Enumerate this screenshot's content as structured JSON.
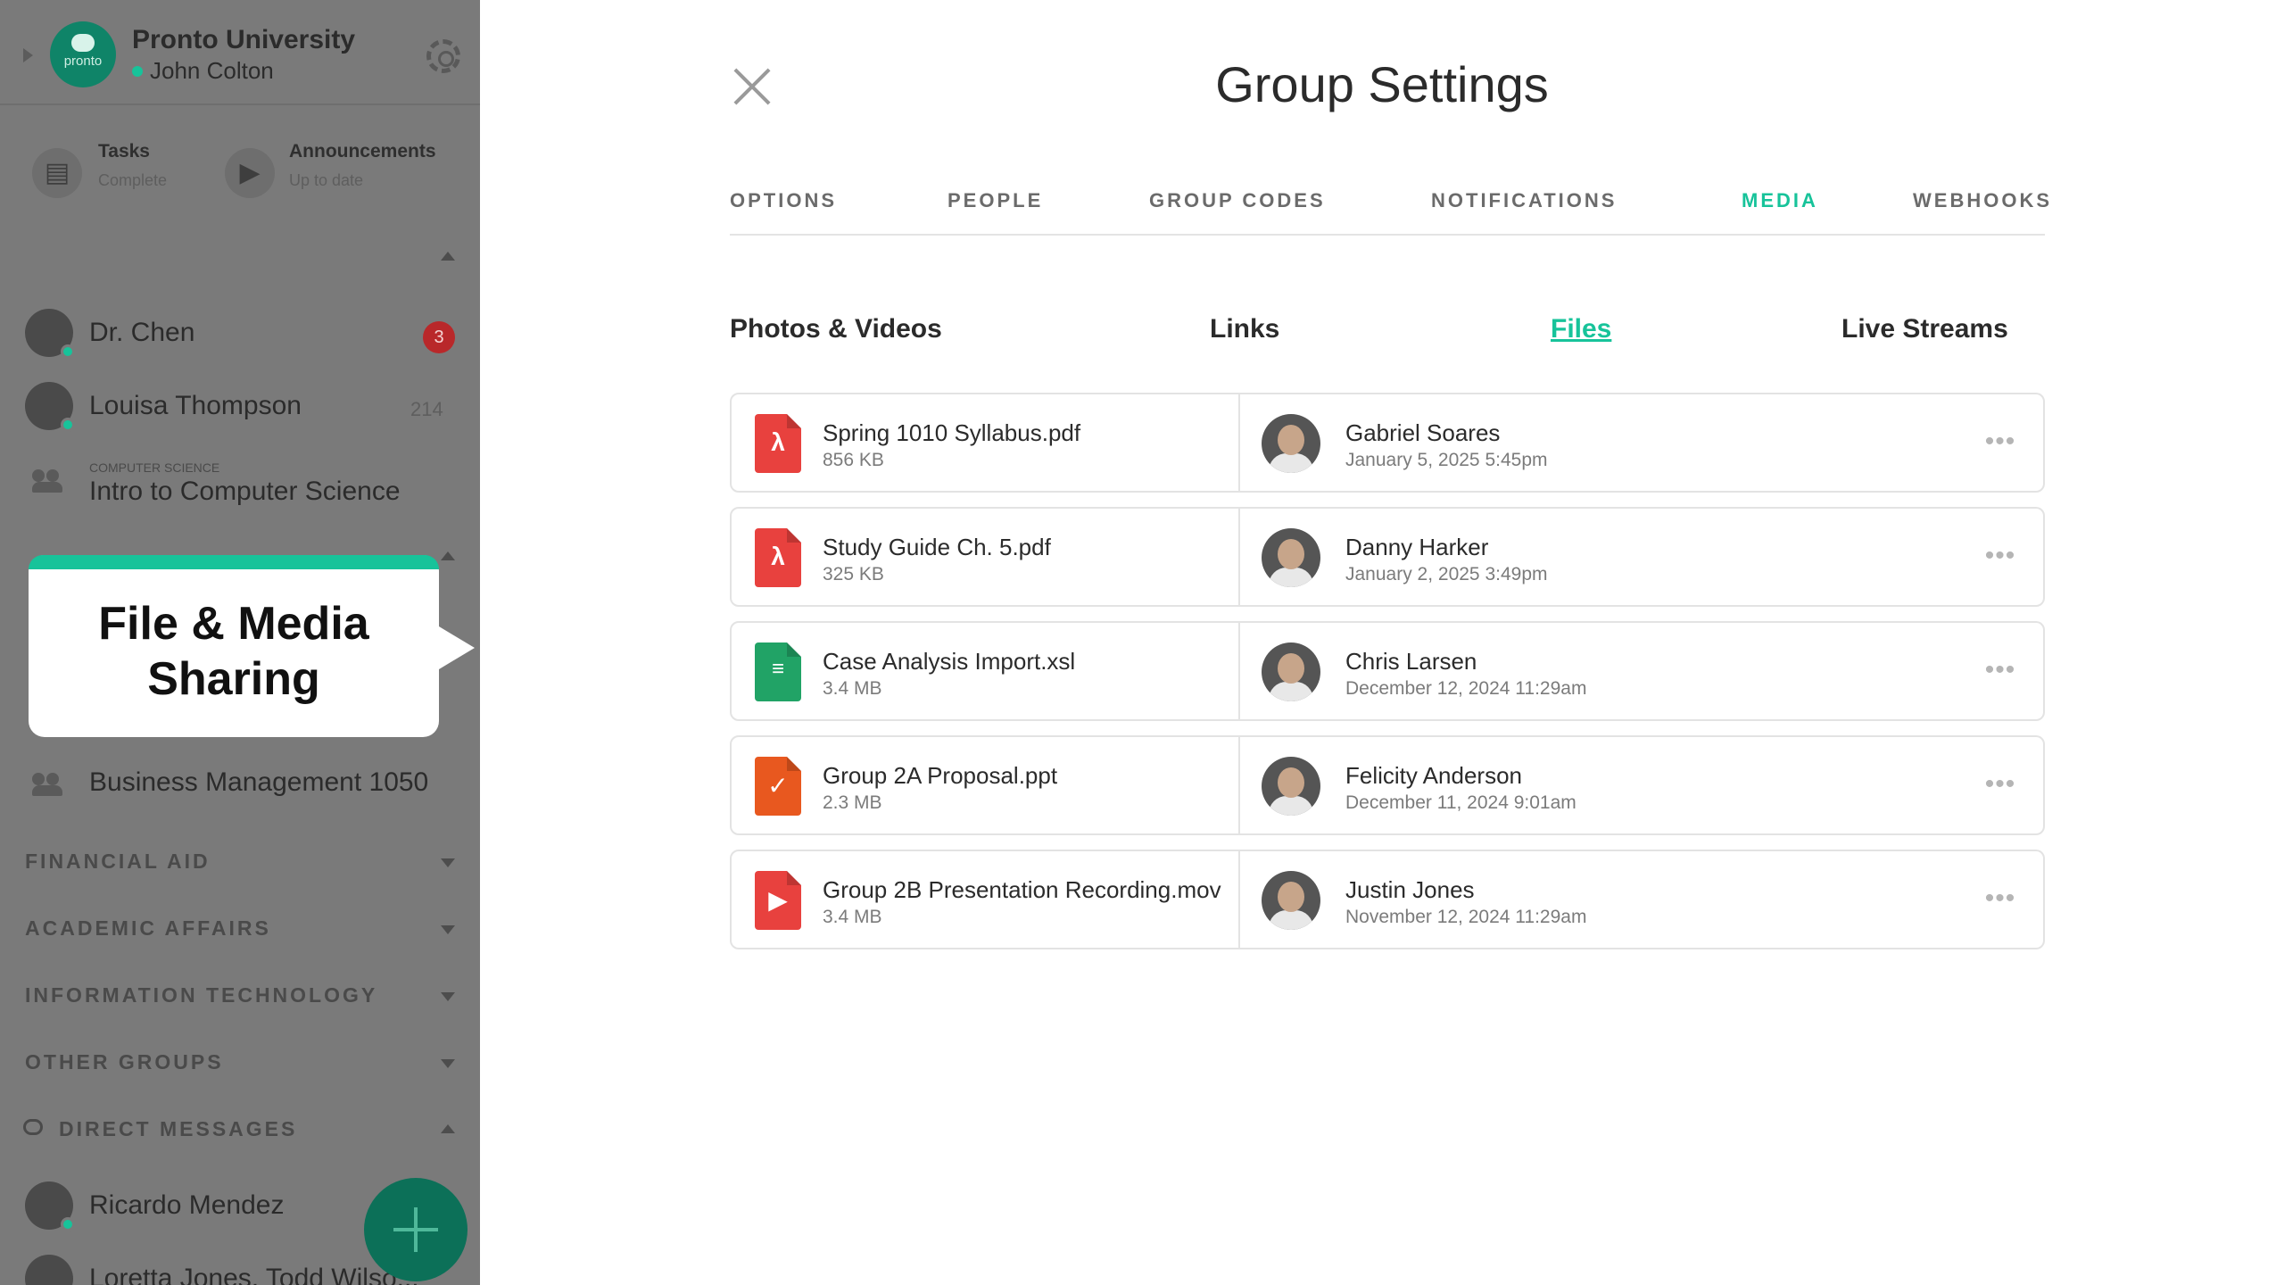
{
  "sidebar": {
    "org_name": "Pronto University",
    "logo_text": "pronto",
    "user_name": "John Colton",
    "status": [
      {
        "title": "Tasks",
        "sub": "Complete",
        "icon": "clipboard-icon"
      },
      {
        "title": "Announcements",
        "sub": "Up to date",
        "icon": "megaphone-icon"
      }
    ],
    "chats": [
      {
        "name": "Dr. Chen",
        "badge": "3"
      },
      {
        "name": "Louisa Thompson",
        "count": "214"
      }
    ],
    "group": {
      "category": "COMPUTER SCIENCE",
      "name": "Intro to Computer Science"
    },
    "group2": {
      "name": "Business Management 1050"
    },
    "sections": [
      "FINANCIAL AID",
      "ACADEMIC AFFAIRS",
      "INFORMATION TECHNOLOGY",
      "OTHER GROUPS"
    ],
    "direct_messages_label": "DIRECT MESSAGES",
    "dms": [
      "Ricardo Mendez",
      "Loretta Jones, Todd Wilso..."
    ],
    "callout_line1": "File & Media",
    "callout_line2": "Sharing",
    "colors": {
      "accent": "#17c39a",
      "badge": "#b9282a"
    }
  },
  "modal": {
    "title": "Group Settings",
    "tabs": [
      "OPTIONS",
      "PEOPLE",
      "GROUP CODES",
      "NOTIFICATIONS",
      "MEDIA",
      "WEBHOOKS"
    ],
    "active_tab": "MEDIA",
    "subtabs": [
      "Photos & Videos",
      "Links",
      "Files",
      "Live Streams"
    ],
    "active_subtab": "Files",
    "files": [
      {
        "name": "Spring 1010 Syllabus.pdf",
        "size": "856 KB",
        "type": "pdf",
        "icon": "pdf-file-icon",
        "color": "#e8413e",
        "person": "Gabriel Soares",
        "date": "January 5, 2025 5:45pm"
      },
      {
        "name": "Study Guide Ch. 5.pdf",
        "size": "325 KB",
        "type": "pdf",
        "icon": "pdf-file-icon",
        "color": "#e8413e",
        "person": "Danny Harker",
        "date": "January 2, 2025 3:49pm"
      },
      {
        "name": "Case Analysis Import.xsl",
        "size": "3.4 MB",
        "type": "xls",
        "icon": "spreadsheet-file-icon",
        "color": "#21a366",
        "person": "Chris Larsen",
        "date": "December 12, 2024 11:29am"
      },
      {
        "name": "Group 2A Proposal.ppt",
        "size": "2.3 MB",
        "type": "ppt",
        "icon": "presentation-file-icon",
        "color": "#e8581f",
        "person": "Felicity Anderson",
        "date": "December 11, 2024 9:01am"
      },
      {
        "name": "Group 2B Presentation Recording.mov",
        "size": "3.4 MB",
        "type": "mov",
        "icon": "video-file-icon",
        "color": "#e8413e",
        "person": "Justin Jones",
        "date": "November 12, 2024 11:29am"
      }
    ],
    "more_label": "•••"
  }
}
